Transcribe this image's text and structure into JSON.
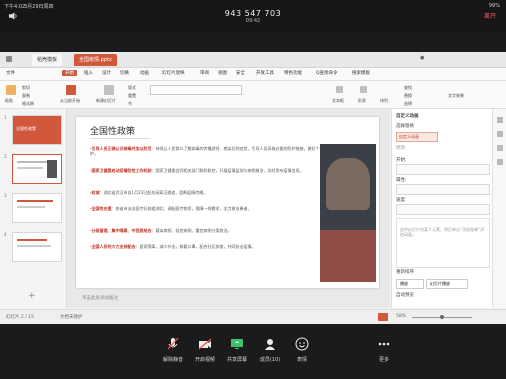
{
  "status_bar": {
    "time": "下午4:02",
    "date": "3月29日周四",
    "wifi": "",
    "battery": "99%"
  },
  "meeting": {
    "id": "943 547 703",
    "elapsed": "09:42",
    "leave_label": "离开"
  },
  "tabs": [
    {
      "label": "稻壳模板"
    },
    {
      "label": "全国疫情.pptx"
    }
  ],
  "menus": [
    "文件",
    "开始",
    "插入",
    "设计",
    "切换",
    "动画",
    "幻灯片放映",
    "审阅",
    "视图",
    "安全",
    "开发工具",
    "特色功能",
    "Q查找命令",
    "搜索模板"
  ],
  "ribbon": [
    "粘贴",
    "剪切",
    "复制",
    "格式刷",
    "从当前开始",
    "新建幻灯片",
    "版式",
    "重置",
    "节",
    "文本框",
    "形状",
    "排列",
    "查找",
    "替换",
    "选择",
    "文字效果"
  ],
  "slide": {
    "title": "全国性政策",
    "paragraphs": [
      {
        "head": "·引导人员正确认识病毒并加以防范",
        "body": "：持续让人民群众了解病毒的传播途径、感染后的症状，引导人员采取必要的防护措施，做好个人防护。"
      },
      {
        "head": "·国家卫健委启动疫情防控工作机制",
        "body": "：国家卫健委会同相关部门联防联控，开展疫情监测与病例救治，及时发布疫情信息。"
      },
      {
        "head": "·封城",
        "body": "：湖北省武汉市自1月23日起关闭离汉通道，阻断疫情传播。"
      },
      {
        "head": "·全国性支援",
        "body": "：各省市派出医疗队驰援湖北，调配医疗物资，保障一线需求，全力救治患者。"
      },
      {
        "head": "·分级管理、集中隔离、中西医结合",
        "body": "：疑似病例、轻症病例、重症病例分类收治。"
      },
      {
        "head": "·全国人民的大力支持配合",
        "body": "：居家隔离，减少外出，佩戴口罩，配合社区排查，共同抗击疫情。"
      }
    ]
  },
  "thumbnails": [
    {
      "num": "1",
      "title": "全国性政策"
    },
    {
      "num": "2",
      "title": ""
    },
    {
      "num": "3",
      "title": ""
    },
    {
      "num": "4",
      "title": ""
    }
  ],
  "notes_hint": "单击此处添加备注",
  "pane": {
    "title": "自定义动画",
    "select_window": "选择窗格",
    "add_effect": "自定义动画",
    "modify_label": "修改: ",
    "start_label": "开始:",
    "property_label": "属性:",
    "speed_label": "速度:",
    "hint": "选中幻灯片的某个元素，然后单击“添加效果”添加动画。",
    "reorder": "重新排序",
    "play": "播放",
    "preview": "幻灯片播放",
    "autopreview": "自动预览"
  },
  "doc_status": {
    "slide": "幻灯片 2 / 15",
    "theme": "",
    "protect": "文档未保护",
    "zoom": "58%"
  },
  "controls": [
    {
      "label": "解除静音",
      "icon": "mic-off-icon"
    },
    {
      "label": "开启视频",
      "icon": "camera-off-icon"
    },
    {
      "label": "共享屏幕",
      "icon": "share-screen-icon"
    },
    {
      "label": "成员(10)",
      "icon": "members-icon"
    },
    {
      "label": "表情",
      "icon": "emoji-icon"
    },
    {
      "label": "更多",
      "icon": "more-icon"
    }
  ]
}
